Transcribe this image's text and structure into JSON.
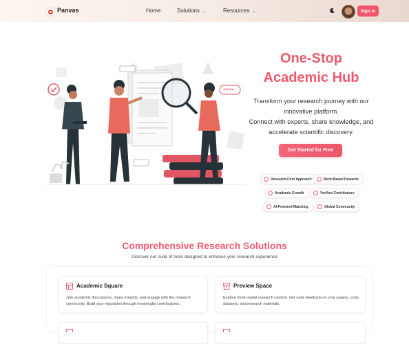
{
  "header": {
    "brand": "Panvas",
    "nav": [
      {
        "label": "Home",
        "has_dropdown": false
      },
      {
        "label": "Solutions",
        "has_dropdown": true
      },
      {
        "label": "Resources",
        "has_dropdown": true
      }
    ],
    "theme_icon": "moon-icon",
    "signin_label": "Sign In"
  },
  "hero": {
    "title_line1": "One-Stop",
    "title_line2": "Academic Hub",
    "desc_line1": "Transform your research journey with our",
    "desc_line2": "innovative platform.",
    "desc_line3": "Connect with experts, share knowledge, and",
    "desc_line4": "accelerate scientific discovery.",
    "cta_label": "Get Started for Free",
    "illustration_badge": "****",
    "features": [
      {
        "label": "Research-First Approach",
        "icon": "target-icon"
      },
      {
        "label": "Merit-Based Rewards",
        "icon": "medal-icon"
      },
      {
        "label": "Academic Growth",
        "icon": "trend-icon"
      },
      {
        "label": "Verified Contributors",
        "icon": "shield-icon"
      },
      {
        "label": "AI-Powered Matching",
        "icon": "chip-icon"
      },
      {
        "label": "Global Community",
        "icon": "globe-icon"
      }
    ]
  },
  "solutions": {
    "title": "Comprehensive Research Solutions",
    "subtitle": "Discover our suite of tools designed to enhance your research experience",
    "cards": [
      {
        "title": "Academic Square",
        "icon": "layout-icon",
        "desc": "Join academic discussions, share insights, and engage with the research community. Build your reputation through meaningful contributions."
      },
      {
        "title": "Preview Space",
        "icon": "archive-icon",
        "desc": "Explore multi-modal research content. Get early feedback on your papers, code, datasets, and research materials."
      }
    ]
  },
  "colors": {
    "accent": "#ee5a6e",
    "button": "#f0566b"
  }
}
